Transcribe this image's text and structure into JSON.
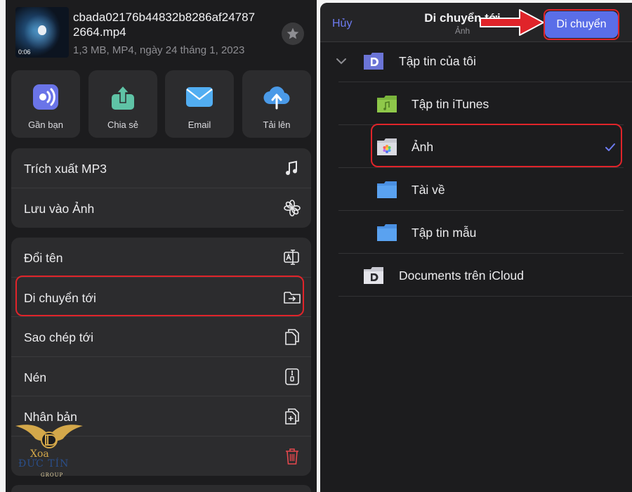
{
  "file": {
    "name_line1": "cbada02176b44832b8286af24787",
    "name_line2": "2664.mp4",
    "meta": "1,3 MB, MP4, ngày 24 tháng 1, 2023",
    "duration": "0:06",
    "favorite_icon": "star-icon"
  },
  "share_actions": [
    {
      "label": "Gần bạn",
      "icon": "airdrop-icon",
      "color": "#6a74e8"
    },
    {
      "label": "Chia sẻ",
      "icon": "share-icon",
      "color": "#5fc3a6"
    },
    {
      "label": "Email",
      "icon": "mail-icon",
      "color": "#52aef2"
    },
    {
      "label": "Tải lên",
      "icon": "cloud-upload-icon",
      "color": "#4a9ae8"
    }
  ],
  "menu_group_1": [
    {
      "label": "Trích xuất MP3",
      "icon": "music-note-icon"
    },
    {
      "label": "Lưu vào Ảnh",
      "icon": "flower-icon"
    }
  ],
  "menu_group_2": [
    {
      "label": "Đổi tên",
      "icon": "rename-icon"
    },
    {
      "label": "Di chuyển tới",
      "icon": "move-folder-icon"
    },
    {
      "label": "Sao chép tới",
      "icon": "copy-icon"
    },
    {
      "label": "Nén",
      "icon": "zip-icon"
    },
    {
      "label": "Nhân bản",
      "icon": "duplicate-icon"
    },
    {
      "label": "",
      "icon": "trash-icon"
    }
  ],
  "logo": {
    "line1": "Xoa",
    "line2": "ĐỨC TÍN",
    "line3": "GROUP"
  },
  "move_dialog": {
    "cancel_label": "Hủy",
    "title": "Di chuyển tới",
    "subtitle": "Ảnh",
    "confirm_label": "Di chuyển",
    "folders": [
      {
        "label": "Tập tin của tôi",
        "icon": "documents-app-folder-icon",
        "level": 0,
        "expanded": true
      },
      {
        "label": "Tập tin iTunes",
        "icon": "itunes-folder-icon",
        "level": 1
      },
      {
        "label": "Ảnh",
        "icon": "photos-folder-icon",
        "level": 1,
        "selected": true
      },
      {
        "label": "Tài về",
        "icon": "folder-icon",
        "level": 1
      },
      {
        "label": "Tập tin mẫu",
        "icon": "folder-icon",
        "level": 1
      },
      {
        "label": "Documents trên iCloud",
        "icon": "icloud-documents-icon",
        "level": 0
      }
    ]
  },
  "colors": {
    "accent": "#5a6ee8",
    "highlight": "#e0242a",
    "destructive": "#e5484d",
    "background": "#1c1c1e",
    "cell": "#2c2c2e"
  }
}
